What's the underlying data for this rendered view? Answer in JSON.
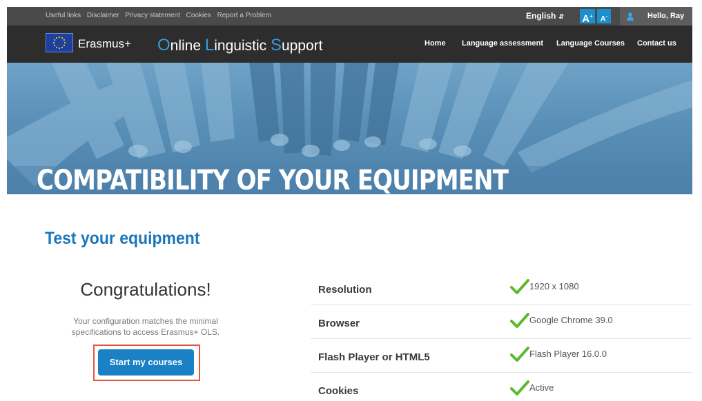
{
  "topbar": {
    "links": [
      "Useful links",
      "Disclaimer",
      "Privacy statement",
      "Cookies",
      "Report a Problem"
    ],
    "language": "English",
    "font_increase_label": "A",
    "font_decrease_label": "A",
    "greeting": "Hello, Ray"
  },
  "header": {
    "erasmus_label": "Erasmus+",
    "ols_title": {
      "parts": [
        {
          "cap": "O",
          "rest": "nline "
        },
        {
          "cap": "L",
          "rest": "inguistic "
        },
        {
          "cap": "S",
          "rest": "upport"
        }
      ]
    },
    "nav": [
      "Home",
      "Language assessment",
      "Language Courses",
      "Contact us"
    ]
  },
  "hero": {
    "title": "COMPATIBILITY OF YOUR EQUIPMENT"
  },
  "main": {
    "section_title": "Test your equipment",
    "congrats_title": "Congratulations!",
    "config_text": "Your configuration matches the minimal specifications to access Erasmus+ OLS.",
    "start_button": "Start my courses",
    "checks": [
      {
        "label": "Resolution",
        "value": "1920 x 1080",
        "status": "ok"
      },
      {
        "label": "Browser",
        "value": "Google Chrome 39.0",
        "status": "ok"
      },
      {
        "label": "Flash Player or HTML5",
        "value": "Flash Player 16.0.0",
        "status": "ok"
      },
      {
        "label": "Cookies",
        "value": "Active",
        "status": "ok"
      }
    ]
  },
  "colors": {
    "accent": "#1a81c4",
    "title_blue": "#1977ba",
    "check_green": "#5cb82e",
    "highlight_frame": "#e8553d",
    "nav_bg": "#2d2d2d",
    "topbar_bg": "#4a4a4a"
  },
  "icons": {
    "check": "check-icon",
    "user": "user-icon",
    "flag": "eu-flag-icon"
  }
}
